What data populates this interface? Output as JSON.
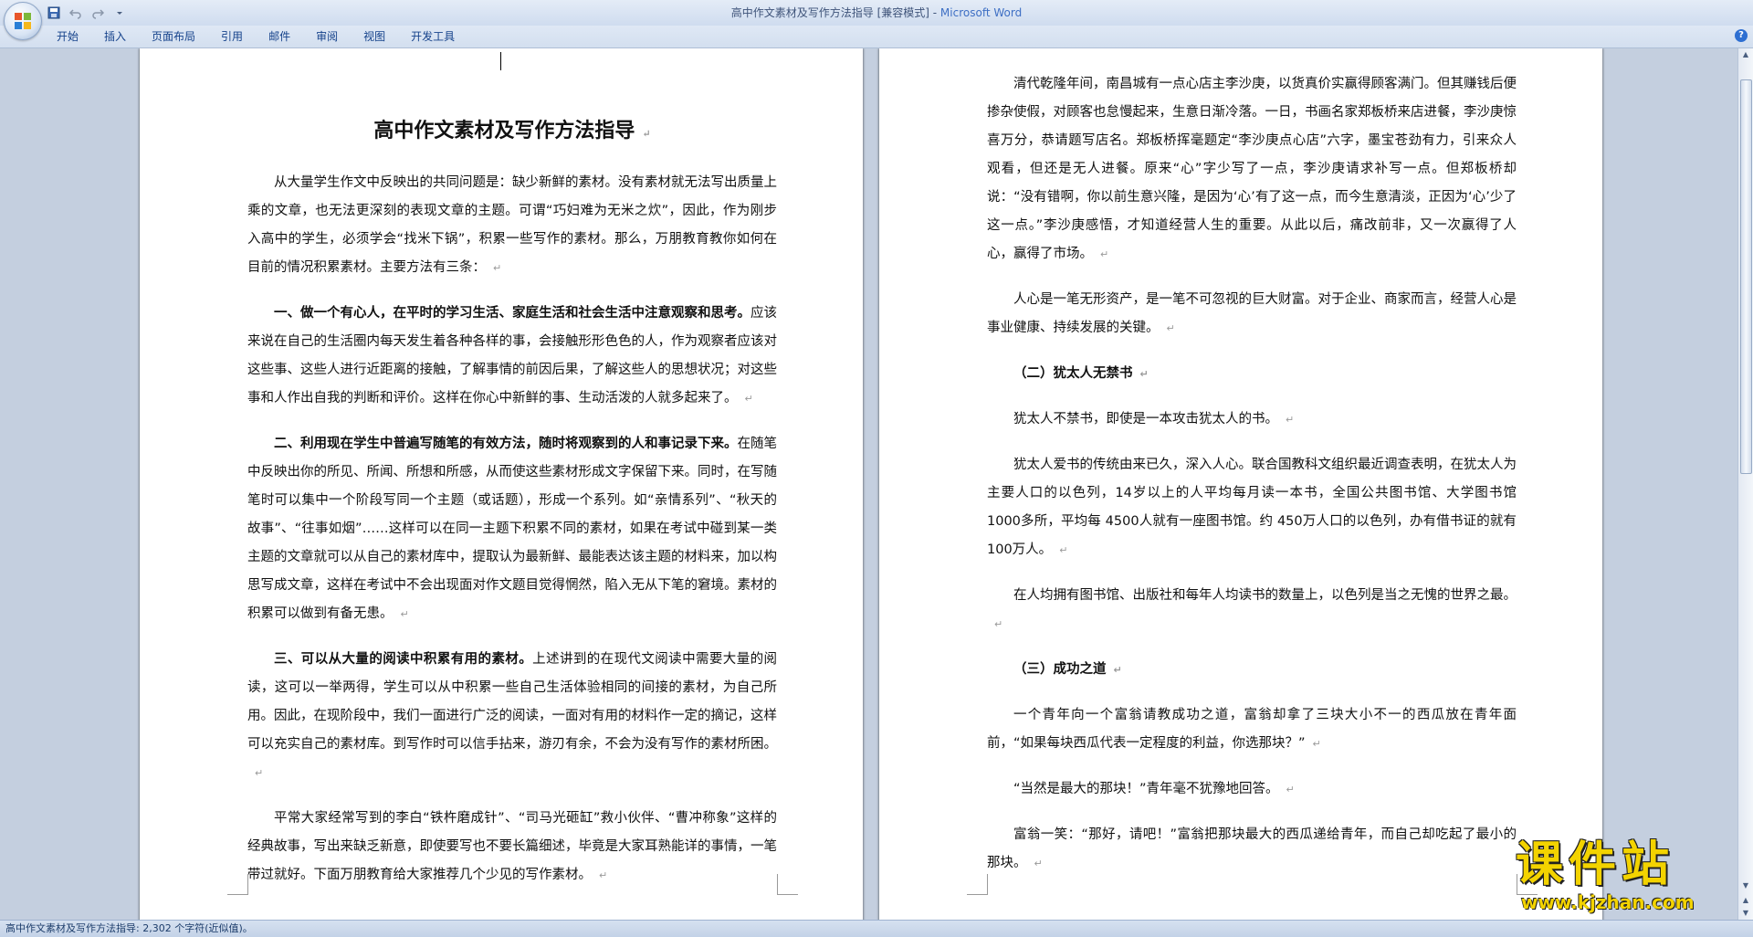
{
  "window": {
    "title": "高中作文素材及写作方法指导 [兼容模式] - ",
    "brand": "Microsoft Word"
  },
  "ribbon": {
    "tabs": [
      "开始",
      "插入",
      "页面布局",
      "引用",
      "邮件",
      "审阅",
      "视图",
      "开发工具"
    ]
  },
  "quick_access": {
    "icons": [
      "save-icon",
      "undo-icon",
      "redo-icon",
      "customize-icon"
    ]
  },
  "left_page": {
    "title": "高中作文素材及写作方法指导",
    "p1": "从大量学生作文中反映出的共同问题是：缺少新鲜的素材。没有素材就无法写出质量上乘的文章，也无法更深刻的表现文章的主题。可谓“巧妇难为无米之炊”，因此，作为刚步入高中的学生，必须学会“找米下锅”，积累一些写作的素材。那么，万朋教育教你如何在目前的情况积累素材。主要方法有三条：",
    "h1_bold": "一、做一个有心人，在平时的学习生活、家庭生活和社会生活中注意观察和思考。",
    "h1_rest": "应该来说在自己的生活圈内每天发生着各种各样的事，会接触形形色色的人，作为观察者应该对这些事、这些人进行近距离的接触，了解事情的前因后果，了解这些人的思想状况；对这些事和人作出自我的判断和评价。这样在你心中新鲜的事、生动活泼的人就多起来了。",
    "h2_bold": "二、利用现在学生中普遍写随笔的有效方法，随时将观察到的人和事记录下来。",
    "h2_rest": "在随笔中反映出你的所见、所闻、所想和所感，从而使这些素材形成文字保留下来。同时，在写随笔时可以集中一个阶段写同一个主题（或话题），形成一个系列。如“亲情系列”、“秋天的故事”、“往事如烟”……这样可以在同一主题下积累不同的素材，如果在考试中碰到某一类主题的文章就可以从自己的素材库中，提取认为最新鲜、最能表达该主题的材料来，加以构思写成文章，这样在考试中不会出现面对作文题目觉得惘然，陷入无从下笔的窘境。素材的积累可以做到有备无患。",
    "h3_bold": "三、可以从大量的阅读中积累有用的素材。",
    "h3_rest": "上述讲到的在现代文阅读中需要大量的阅读，这可以一举两得，学生可以从中积累一些自己生活体验相同的间接的素材，为自己所用。因此，在现阶段中，我们一面进行广泛的阅读，一面对有用的材料作一定的摘记，这样可以充实自己的素材库。到写作时可以信手拈来，游刃有余，不会为没有写作的素材所困。",
    "p5": "平常大家经常写到的李白“铁杵磨成针”、“司马光砸缸”救小伙伴、“曹冲称象”这样的经典故事，写出来缺乏新意，即使要写也不要长篇细述，毕竟是大家耳熟能详的事情，一笔带过就好。下面万朋教育给大家推荐几个少见的写作素材。"
  },
  "right_page": {
    "p1": "清代乾隆年间，南昌城有一点心店主李沙庚，以货真价实赢得顾客满门。但其赚钱后便掺杂使假，对顾客也怠慢起来，生意日渐冷落。一日，书画名家郑板桥来店进餐，李沙庚惊喜万分，恭请题写店名。郑板桥挥毫题定“李沙庚点心店”六字，墨宝苍劲有力，引来众人观看，但还是无人进餐。原来“心”字少写了一点，李沙庚请求补写一点。但郑板桥却说：“没有错啊，你以前生意兴隆，是因为‘心’有了这一点，而今生意清淡，正因为‘心’少了这一点。”李沙庚感悟，才知道经营人生的重要。从此以后，痛改前非，又一次赢得了人心，赢得了市场。",
    "p2": "人心是一笔无形资产，是一笔不可忽视的巨大财富。对于企业、商家而言，经营人心是事业健康、持续发展的关键。",
    "h2": "（二）犹太人无禁书",
    "p3": "犹太人不禁书，即使是一本攻击犹太人的书。",
    "p4": "犹太人爱书的传统由来已久，深入人心。联合国教科文组织最近调查表明，在犹太人为主要人口的以色列，14岁以上的人平均每月读一本书，全国公共图书馆、大学图书馆 1000多所，平均每 4500人就有一座图书馆。约 450万人口的以色列，办有借书证的就有 100万人。",
    "p5": "在人均拥有图书馆、出版社和每年人均读书的数量上，以色列是当之无愧的世界之最。",
    "h3": "（三）成功之道",
    "p6": "一个青年向一个富翁请教成功之道，富翁却拿了三块大小不一的西瓜放在青年面前，“如果每块西瓜代表一定程度的利益，你选那块？”",
    "p7": "“当然是最大的那块！”青年毫不犹豫地回答。",
    "p8": "富翁一笑：“那好，请吧！”富翁把那块最大的西瓜递给青年，而自己却吃起了最小的那块。"
  },
  "statusbar": {
    "text": "高中作文素材及写作方法指导: 2,302 个字符(近似值)。"
  },
  "watermark": {
    "cn": "课件站",
    "url": "www.kjzhan.com"
  },
  "paragraph_mark": "↵",
  "colors": {
    "ribbon_text": "#15428b",
    "workspace": "#c4cfdf",
    "watermark": "#f3d300"
  }
}
